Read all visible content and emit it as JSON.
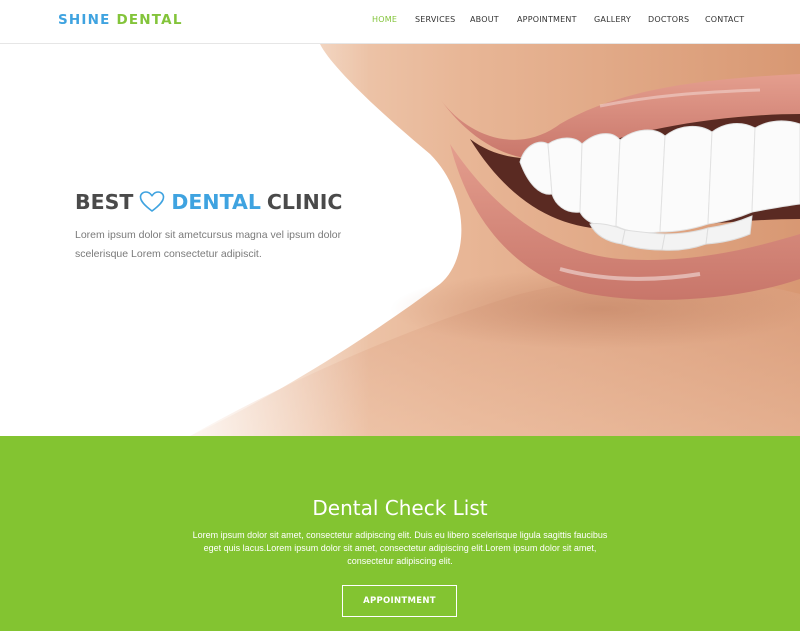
{
  "brand": {
    "part1": "SHINE",
    "part2": "DENTAL",
    "color1": "#3fa3e0",
    "color2": "#83c43a"
  },
  "nav": {
    "active": "HOME",
    "items": [
      "HOME",
      "SERVICES",
      "ABOUT",
      "APPOINTMENT",
      "GALLERY",
      "DOCTORS",
      "CONTACT"
    ]
  },
  "hero": {
    "title_part1": "BEST",
    "title_part2": "DENTAL",
    "title_part3": "CLINIC",
    "icon": "heart-icon",
    "description": "Lorem ipsum dolor sit ametcursus magna vel ipsum dolor scelerisque Lorem consectetur adipiscit.",
    "image": "smiling-mouth-photo"
  },
  "checklist": {
    "title": "Dental Check List",
    "text": "Lorem ipsum dolor sit amet, consectetur adipiscing elit. Duis eu libero scelerisque ligula sagittis faucibus eget quis lacus.Lorem ipsum dolor sit amet, consectetur adipiscing elit.Lorem ipsum dolor sit amet, consectetur adipiscing elit.",
    "button_label": "APPOINTMENT",
    "background": "#83c431"
  }
}
